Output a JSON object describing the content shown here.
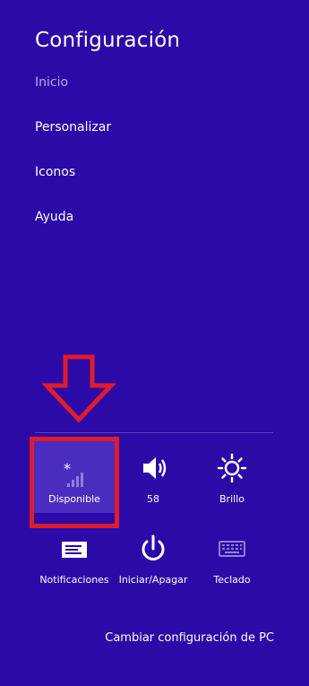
{
  "panel": {
    "title": "Configuración"
  },
  "menu": {
    "items": [
      {
        "label": "Inicio"
      },
      {
        "label": "Personalizar"
      },
      {
        "label": "Iconos"
      },
      {
        "label": "Ayuda"
      }
    ]
  },
  "quick_settings": {
    "network": {
      "label": "Disponible",
      "icon": "network-signal-icon"
    },
    "volume": {
      "label": "58",
      "icon": "speaker-icon"
    },
    "brightness": {
      "label": "Brillo",
      "icon": "brightness-icon"
    },
    "notifications": {
      "label": "Notificaciones",
      "icon": "notifications-icon"
    },
    "power": {
      "label": "Iniciar/Apagar",
      "icon": "power-icon"
    },
    "keyboard": {
      "label": "Teclado",
      "icon": "keyboard-icon"
    }
  },
  "footer": {
    "change_settings_label": "Cambiar configuración de PC"
  },
  "colors": {
    "background": "#2b0aa8",
    "highlight": "#e01b2b",
    "dim_text": "#b9abe8"
  }
}
